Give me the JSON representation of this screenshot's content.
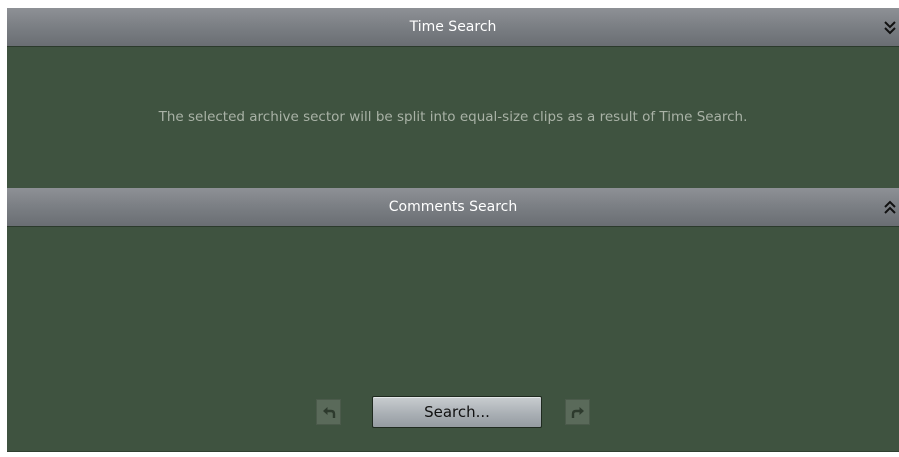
{
  "panels": {
    "time_search": {
      "title": "Time Search",
      "toggle_icon": "double-chevron-down-icon",
      "info": "The selected archive sector will be split into equal-size clips as a result of Time Search."
    },
    "comments_search": {
      "title": "Comments Search",
      "toggle_icon": "double-chevron-up-icon"
    }
  },
  "footer": {
    "search_label": "Search...",
    "back_icon": "back-arrow-icon",
    "forward_icon": "forward-arrow-icon"
  },
  "colors": {
    "panel_background": "#3f5340",
    "header_gradient_top": "#8e9196",
    "header_gradient_bottom": "#6a6e73",
    "info_text": "#a9b2a6",
    "nav_button_disabled": "#5a6a5a"
  }
}
